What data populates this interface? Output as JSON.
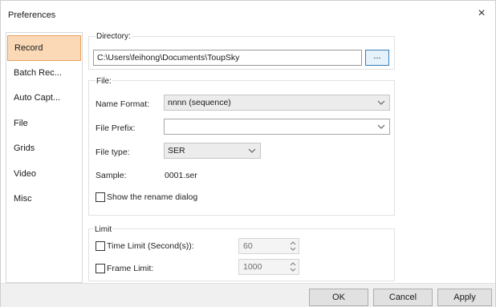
{
  "window": {
    "title": "Preferences",
    "close_glyph": "×"
  },
  "sidebar": {
    "items": [
      {
        "label": "Record",
        "selected": true
      },
      {
        "label": "Batch Rec..."
      },
      {
        "label": "Auto Capt..."
      },
      {
        "label": "File"
      },
      {
        "label": "Grids"
      },
      {
        "label": "Video"
      },
      {
        "label": "Misc"
      }
    ]
  },
  "directory": {
    "group_label": "Directory:",
    "path": "C:\\Users\\feihong\\Documents\\ToupSky",
    "browse_label": "..."
  },
  "file": {
    "group_label": "File:",
    "name_format_label": "Name Format:",
    "name_format_value": "nnnn (sequence)",
    "prefix_label": "File Prefix:",
    "prefix_value": "",
    "type_label": "File type:",
    "type_value": "SER",
    "sample_label": "Sample:",
    "sample_value": "0001.ser",
    "rename_dialog_label": "Show the rename dialog",
    "rename_dialog_checked": false
  },
  "limit": {
    "group_label": "Limit",
    "time_limit_label": "Time Limit (Second(s)):",
    "time_limit_value": "60",
    "time_limit_checked": false,
    "frame_limit_label": "Frame Limit:",
    "frame_limit_value": "1000",
    "frame_limit_checked": false
  },
  "footer": {
    "ok_label": "OK",
    "cancel_label": "Cancel",
    "apply_label": "Apply"
  },
  "colors": {
    "selected_bg": "#fbd9b7",
    "selected_border": "#e8a15d",
    "browse_border": "#3c7fb1"
  },
  "icons": {
    "close": "close-icon",
    "dropdown": "chevron-down-icon",
    "spinner": "spinner-arrows-icon"
  }
}
